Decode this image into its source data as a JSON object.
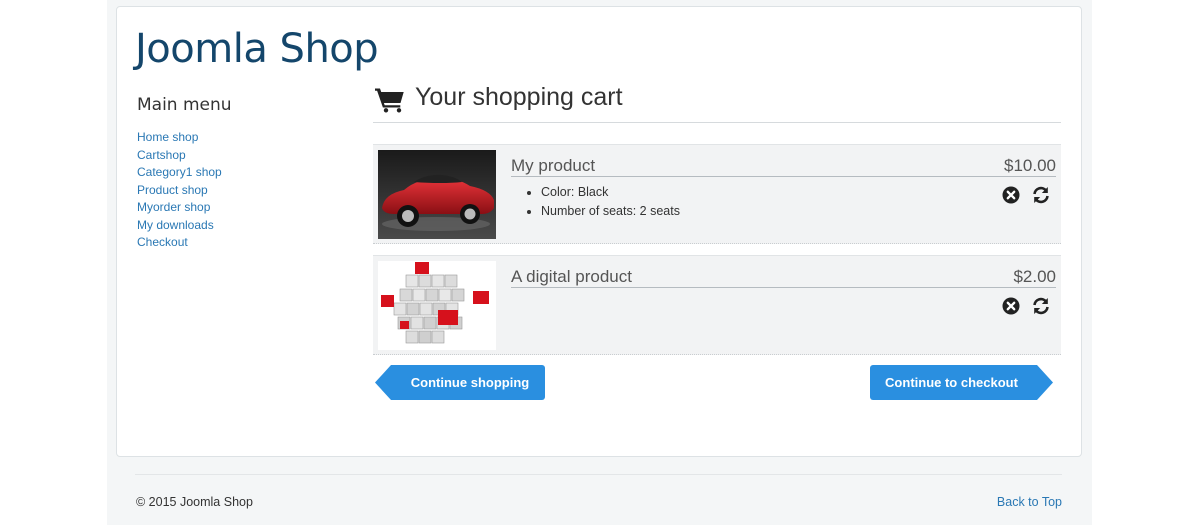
{
  "site": {
    "title": "Joomla Shop"
  },
  "menu": {
    "title": "Main menu",
    "items": [
      {
        "label": "Home shop"
      },
      {
        "label": "Cartshop"
      },
      {
        "label": "Category1 shop"
      },
      {
        "label": "Product shop"
      },
      {
        "label": "Myorder shop"
      },
      {
        "label": "My downloads"
      },
      {
        "label": "Checkout"
      }
    ]
  },
  "cart": {
    "title": "Your shopping cart",
    "items": [
      {
        "name": "My product",
        "price": "$10.00",
        "attributes": [
          "Color: Black",
          "Number of seats: 2 seats"
        ],
        "image": "red-sports-car"
      },
      {
        "name": "A digital product",
        "price": "$2.00",
        "attributes": [],
        "image": "cube-blocks"
      }
    ],
    "continue_shopping": "Continue shopping",
    "continue_checkout": "Continue to checkout"
  },
  "footer": {
    "copyright": "© 2015 Joomla Shop",
    "back_to_top": "Back to Top"
  },
  "colors": {
    "title": "#14466b",
    "link": "#2a78b4",
    "button": "#2a8fe0",
    "item_bg": "#f2f3f4"
  },
  "icons": {
    "cart": "shopping-cart-icon",
    "remove": "remove-circle-icon",
    "update": "refresh-icon"
  }
}
